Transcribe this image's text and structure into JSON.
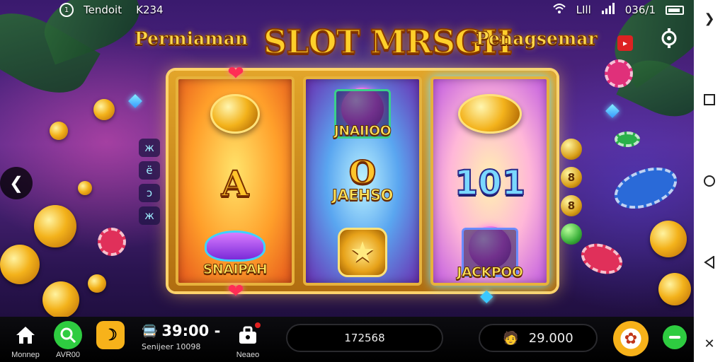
{
  "status_bar": {
    "left_text": "Tendoit",
    "left_icon_text": "1",
    "carrier": "K234",
    "signal_text": "LIll",
    "time": "036/1"
  },
  "title": {
    "left": "Permiaman",
    "main": "SLOT MRSGH",
    "right": "Penagsemar"
  },
  "reels": [
    {
      "symbols": [
        "coin",
        "A",
        "SNAIPAH"
      ]
    },
    {
      "symbols": [
        "JNAIIOO",
        "0 JAEHSO",
        "star-coin"
      ]
    },
    {
      "symbols": [
        "gold-coins",
        "101",
        "JACKPOO"
      ]
    }
  ],
  "reel_labels": {
    "r1_big": "A",
    "r1_bottom": "SNAIPAH",
    "r2_top": "JNAIIOO",
    "r2_big": "O",
    "r2_mid": "JAEHSO",
    "r3_big": "101",
    "r3_bottom": "JACKPOO"
  },
  "side_icons": [
    "ж",
    "ë",
    "ɔ",
    "ж"
  ],
  "side_badges": [
    "8",
    "8"
  ],
  "bottom_bar": {
    "home_label": "Monnep",
    "search_label": "AVR00",
    "moon_label": "",
    "time_value": "39:00 -",
    "time_sub": "Senijeer 10098",
    "bag_label": "Neaeo",
    "input_text": "172568",
    "balance": "29.000"
  },
  "colors": {
    "title_gold": "#ffd84a",
    "accent_green": "#2ecc40",
    "accent_orange": "#f7b21a"
  }
}
